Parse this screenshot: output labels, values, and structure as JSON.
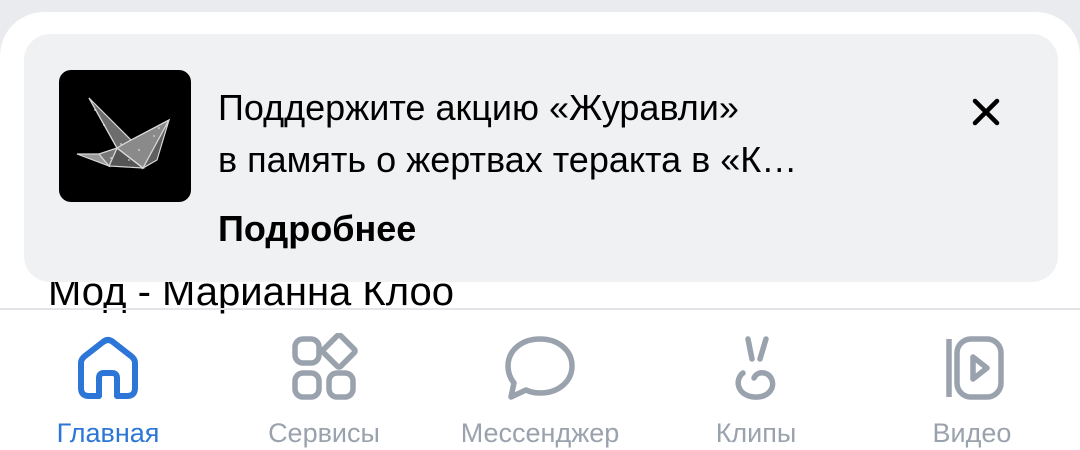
{
  "background": {
    "partial_text": "Мод - Марианна Клоо"
  },
  "banner": {
    "title_line1": "Поддержите акцию «Журавли»",
    "title_line2": "в память о жертвах теракта в «К…",
    "link": "Подробнее",
    "thumbnail_icon": "origami-crane-icon",
    "close_icon": "close-icon"
  },
  "tabbar": {
    "items": [
      {
        "label": "Главная",
        "icon": "home-icon",
        "active": true
      },
      {
        "label": "Сервисы",
        "icon": "services-icon",
        "active": false
      },
      {
        "label": "Мессенджер",
        "icon": "messenger-icon",
        "active": false
      },
      {
        "label": "Клипы",
        "icon": "clips-icon",
        "active": false
      },
      {
        "label": "Видео",
        "icon": "video-icon",
        "active": false
      }
    ]
  },
  "colors": {
    "accent": "#2b76d6",
    "inactive": "#99a2ad",
    "banner_bg": "#f0f1f3"
  }
}
